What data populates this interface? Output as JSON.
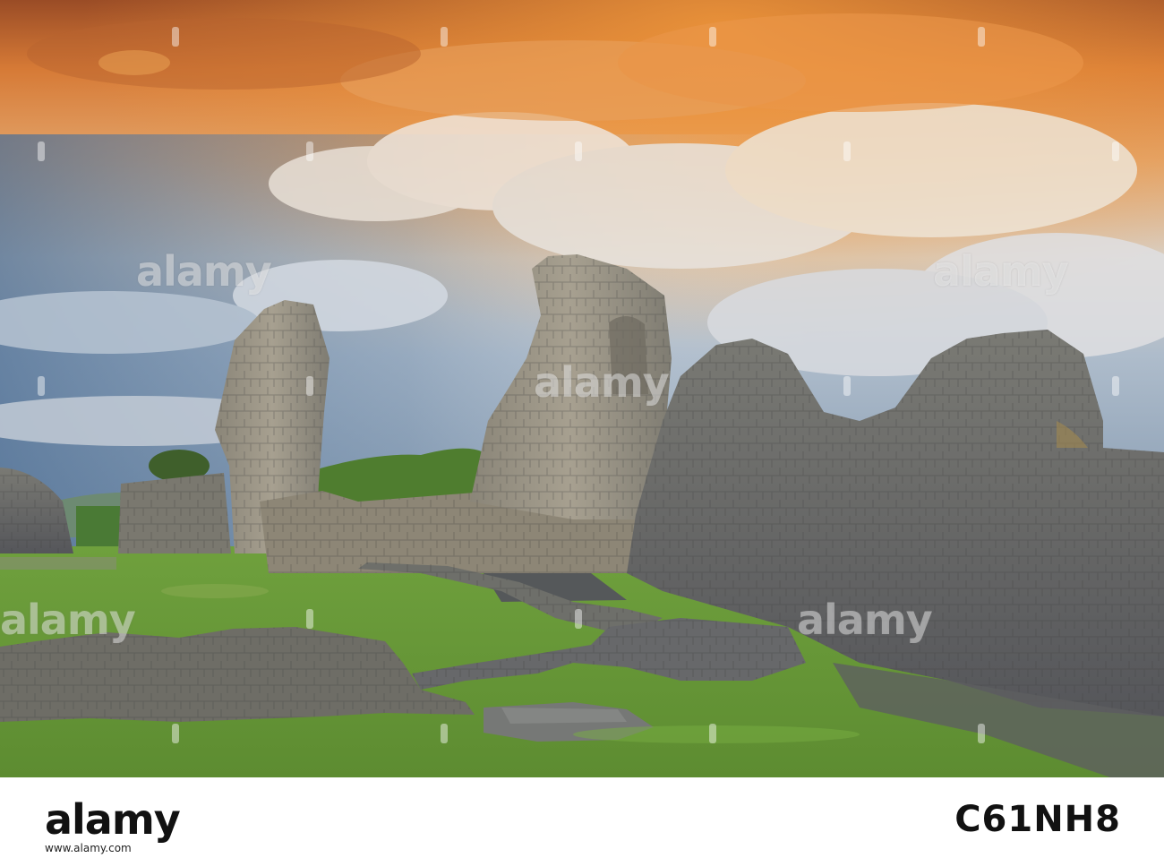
{
  "photo": {
    "subject": "castle-ruins-at-sunset",
    "colors": {
      "sky_top": "#b4602a",
      "sky_orange": "#e68a3c",
      "sky_blue": "#6f8fb0",
      "cloud_white": "#e7e2dc",
      "stone": "#8c8a80",
      "stone_dark": "#5c5c56",
      "grass": "#6c9e3a",
      "trees": "#4d7a30"
    }
  },
  "watermarks": {
    "text": "alamy"
  },
  "footer": {
    "logo": "alamy",
    "url": "www.alamy.com",
    "image_id": "C61NH8"
  }
}
